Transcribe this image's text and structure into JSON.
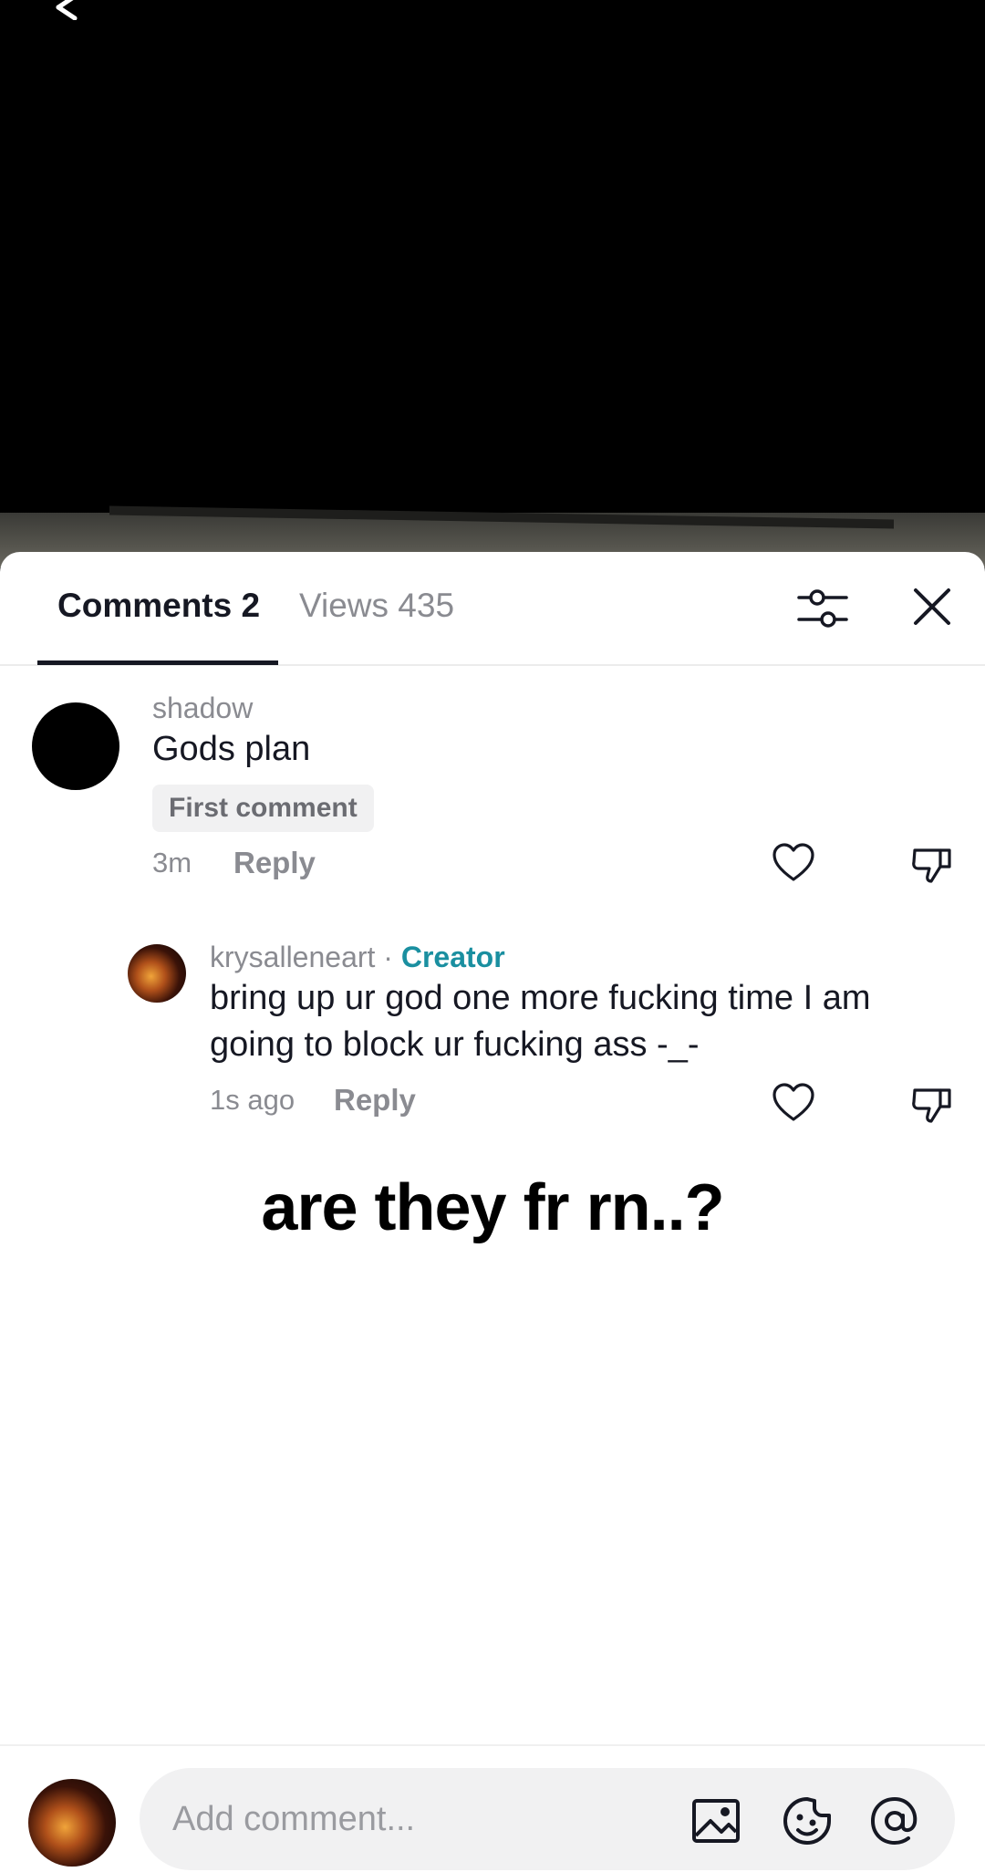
{
  "tabs": {
    "comments_label": "Comments 2",
    "views_label": "Views 435"
  },
  "comments": [
    {
      "username": "shadow",
      "text": "Gods plan",
      "badge": "First comment",
      "time": "3m",
      "reply_label": "Reply"
    },
    {
      "username": "krysalleneart",
      "separator": " · ",
      "creator_label": "Creator",
      "text": "bring up ur god one more fucking time I am going to block ur fucking ass -_-",
      "time": "1s ago",
      "reply_label": "Reply"
    }
  ],
  "overlay_caption": "are they fr rn..?",
  "composer": {
    "placeholder": "Add comment..."
  },
  "colors": {
    "creator_accent": "#1a8fa0",
    "text_primary": "#161823",
    "text_secondary": "#8a8b91",
    "input_bg": "#f1f1f2"
  },
  "icons": [
    "back-arrow-icon",
    "filter-icon",
    "close-icon",
    "heart-icon",
    "dislike-icon",
    "image-icon",
    "emoji-icon",
    "mention-icon"
  ]
}
